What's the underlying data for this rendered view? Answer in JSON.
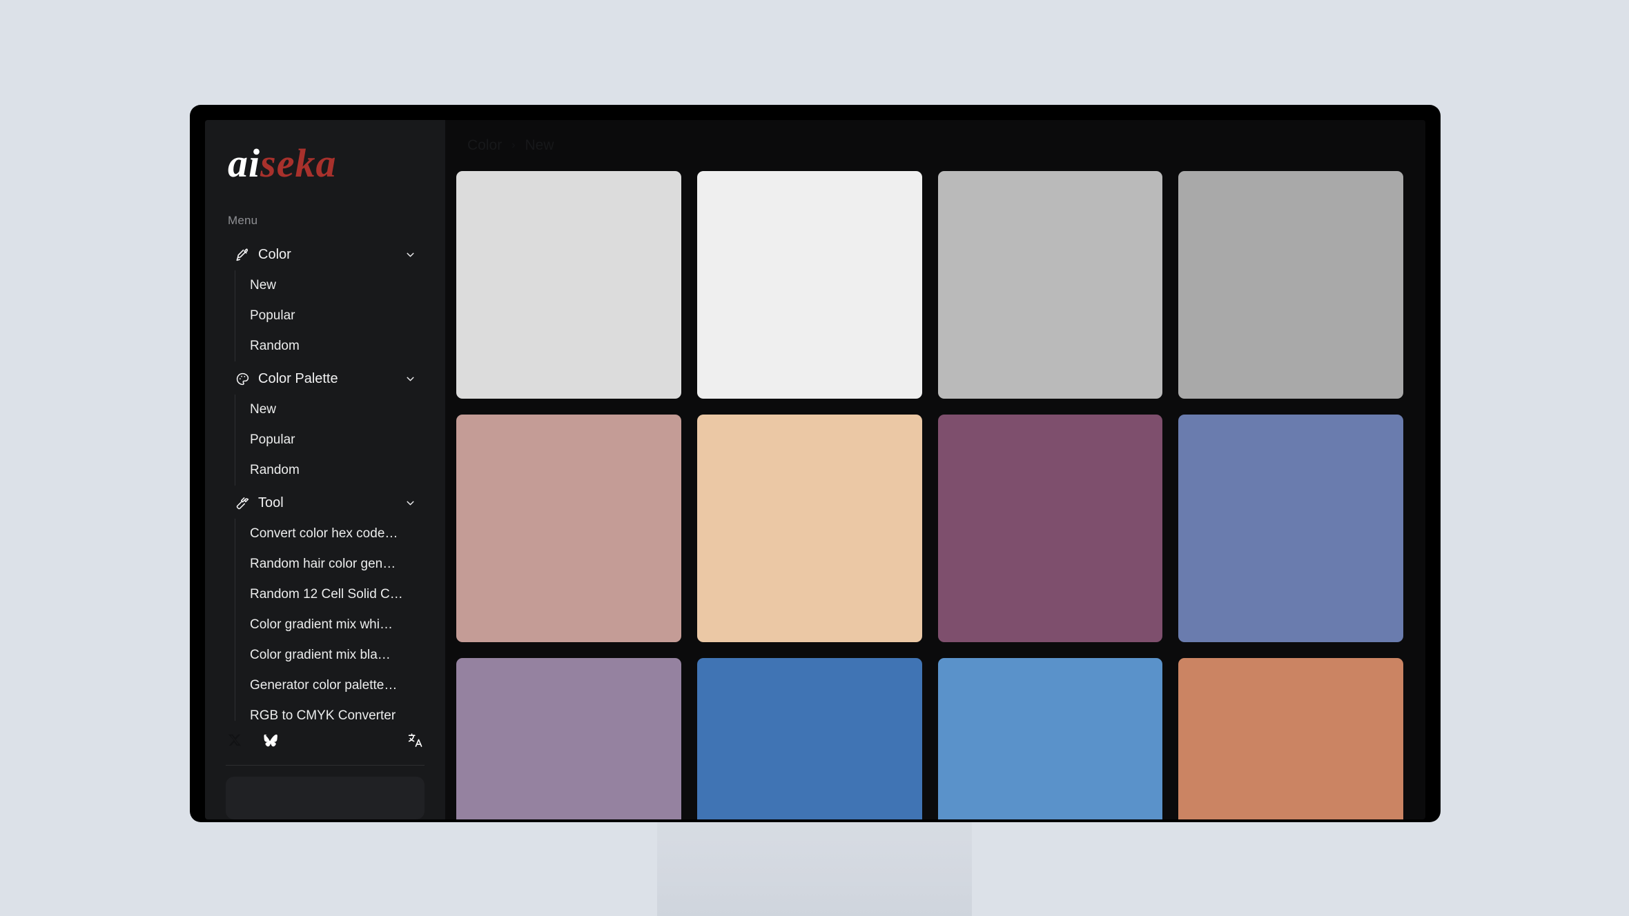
{
  "app": {
    "logo_primary": "ai",
    "logo_secondary": "seka"
  },
  "sidebar": {
    "menu_label": "Menu",
    "groups": [
      {
        "label": "Color",
        "icon": "eyedropper-icon",
        "expanded": true,
        "chevron": "chevron-down-icon",
        "children": [
          {
            "label": "New"
          },
          {
            "label": "Popular"
          },
          {
            "label": "Random"
          }
        ]
      },
      {
        "label": "Color Palette",
        "icon": "palette-icon",
        "expanded": true,
        "chevron": "chevron-down-icon",
        "children": [
          {
            "label": "New"
          },
          {
            "label": "Popular"
          },
          {
            "label": "Random"
          }
        ]
      },
      {
        "label": "Tool",
        "icon": "hammer-icon",
        "expanded": true,
        "chevron": "chevron-down-icon",
        "children": [
          {
            "label": "Convert color hex code…"
          },
          {
            "label": "Random hair color gen…"
          },
          {
            "label": "Random 12 Cell Solid C…"
          },
          {
            "label": "Color gradient mix whi…"
          },
          {
            "label": "Color gradient mix bla…"
          },
          {
            "label": "Generator color palette…"
          },
          {
            "label": "RGB to CMYK Converter"
          }
        ]
      }
    ],
    "footer": {
      "social": [
        {
          "name": "x-twitter-icon"
        },
        {
          "name": "bluesky-butterfly-icon"
        }
      ],
      "language": {
        "name": "translate-language-icon"
      }
    }
  },
  "main": {
    "breadcrumb": {
      "items": [
        "Color",
        "New"
      ],
      "separator": "›"
    },
    "swatches": [
      {
        "hex": "#dcdcdc"
      },
      {
        "hex": "#efefef"
      },
      {
        "hex": "#bababa"
      },
      {
        "hex": "#a9a9a9"
      },
      {
        "hex": "#c49c96"
      },
      {
        "hex": "#ebc8a5"
      },
      {
        "hex": "#7e4f6d"
      },
      {
        "hex": "#6a7cae"
      },
      {
        "hex": "#9582a0"
      },
      {
        "hex": "#4074b4"
      },
      {
        "hex": "#5a92ca"
      },
      {
        "hex": "#cb8463"
      }
    ]
  },
  "theme": {
    "page_background": "#dce1e8",
    "screen_background": "#0b0b0c",
    "sidebar_background": "#18191b",
    "logo_accent": "#a8312c"
  }
}
